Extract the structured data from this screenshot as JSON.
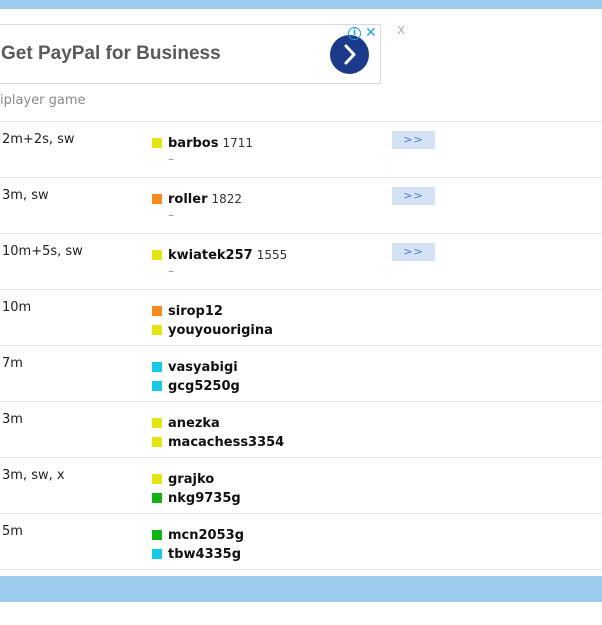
{
  "ad": {
    "text": "Get PayPal for Business",
    "info_glyph": "i",
    "close_glyph": "✕",
    "icons": [
      "arrow-right-icon",
      "info-icon",
      "close-icon"
    ],
    "colors": {
      "arrow_bg": "#1b3a8a",
      "adchoices": "#1aa2e4"
    }
  },
  "close_label": "x",
  "section_title": "iplayer game",
  "colors": {
    "header_bar": "#9ccbee",
    "button_bg": "#d3e2f4",
    "button_text": "#4e7fc2",
    "dot_yellow": "#e5e516",
    "dot_orange": "#f68c1e",
    "dot_cyan": "#17c8e9",
    "dot_green": "#12b312"
  },
  "rows": [
    {
      "time_control": "2m+2s, sw",
      "players": [
        {
          "name": "barbos",
          "rating": "1711",
          "color": "#e5e516"
        }
      ],
      "second_line": "–",
      "button": ">>"
    },
    {
      "time_control": "3m, sw",
      "players": [
        {
          "name": "roller",
          "rating": "1822",
          "color": "#f68c1e"
        }
      ],
      "second_line": "–",
      "button": ">>"
    },
    {
      "time_control": "10m+5s, sw",
      "players": [
        {
          "name": "kwiatek257",
          "rating": "1555",
          "color": "#e5e516"
        }
      ],
      "second_line": "–",
      "button": ">>"
    },
    {
      "time_control": "10m",
      "players": [
        {
          "name": "sirop12",
          "color": "#f68c1e"
        },
        {
          "name": "youyouorigina",
          "color": "#e5e516"
        }
      ]
    },
    {
      "time_control": "7m",
      "players": [
        {
          "name": "vasyabigi",
          "color": "#17c8e9"
        },
        {
          "name": "gcg5250g",
          "color": "#17c8e9"
        }
      ]
    },
    {
      "time_control": "3m",
      "players": [
        {
          "name": "anezka",
          "color": "#e5e516"
        },
        {
          "name": "macachess3354",
          "color": "#e5e516"
        }
      ]
    },
    {
      "time_control": "3m, sw, x",
      "players": [
        {
          "name": "grajko",
          "color": "#e5e516"
        },
        {
          "name": "nkg9735g",
          "color": "#12b312"
        }
      ]
    },
    {
      "time_control": "5m",
      "players": [
        {
          "name": "mcn2053g",
          "color": "#12b312"
        },
        {
          "name": "tbw4335g",
          "color": "#17c8e9"
        }
      ]
    },
    {
      "time_control": "",
      "players": [
        {
          "name": "",
          "color": "#12b312"
        }
      ]
    }
  ]
}
